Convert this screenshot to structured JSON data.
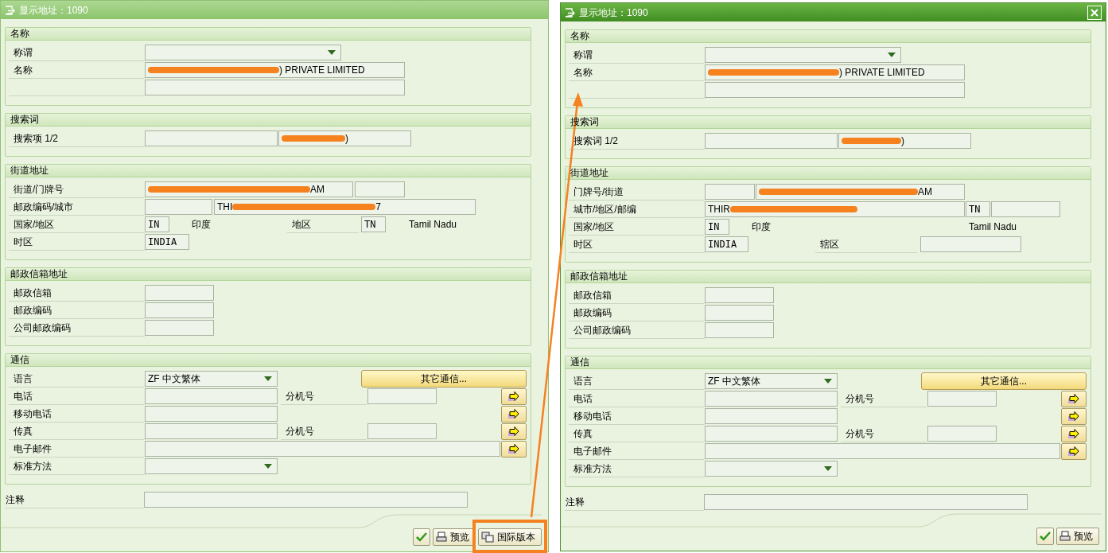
{
  "dialogs": [
    {
      "title": "显示地址：1090",
      "active": false,
      "closable": false,
      "groups": [
        {
          "title": "名称",
          "rows": [
            {
              "label": "称谓",
              "items": [
                {
                  "kind": "dropdown"
                }
              ]
            },
            {
              "label": "名称",
              "items": [
                {
                  "kind": "field",
                  "redacted": true,
                  "value": ") PRIVATE LIMITED"
                }
              ]
            },
            {
              "items": [
                {
                  "kind": "field"
                }
              ]
            }
          ]
        },
        {
          "title": "搜索词",
          "rows": [
            {
              "label": "搜索项 1/2",
              "items": [
                {
                  "kind": "field"
                },
                {
                  "kind": "field",
                  "redacted": true,
                  "value": ")"
                }
              ]
            }
          ]
        },
        {
          "title": "街道地址",
          "rows": [
            {
              "label": "街道/门牌号",
              "items": [
                {
                  "kind": "field",
                  "redacted": true,
                  "value": "AM"
                },
                {
                  "kind": "field"
                }
              ]
            },
            {
              "label": "邮政编码/城市",
              "items": [
                {
                  "kind": "field"
                },
                {
                  "kind": "field",
                  "prefix": "THI",
                  "redacted": true,
                  "value": "7"
                }
              ]
            },
            {
              "label": "国家/地区",
              "items": [
                {
                  "kind": "code_field",
                  "value": "IN"
                },
                {
                  "kind": "text",
                  "text": "印度"
                },
                {
                  "kind": "label",
                  "text": "地区"
                },
                {
                  "kind": "code_field",
                  "value": "TN"
                },
                {
                  "kind": "text",
                  "text": "Tamil Nadu"
                }
              ]
            },
            {
              "label": "时区",
              "items": [
                {
                  "kind": "code_field",
                  "value": "INDIA"
                }
              ]
            }
          ]
        },
        {
          "title": "邮政信箱地址",
          "rows": [
            {
              "label": "邮政信箱",
              "items": [
                {
                  "kind": "field"
                }
              ]
            },
            {
              "label": "邮政编码",
              "items": [
                {
                  "kind": "field"
                }
              ]
            },
            {
              "label": "公司邮政编码",
              "items": [
                {
                  "kind": "field"
                }
              ]
            }
          ]
        },
        {
          "title": "通信",
          "rows": [
            {
              "label": "语言",
              "items": [
                {
                  "kind": "dropdown",
                  "value": "ZF 中文繁体"
                },
                {
                  "kind": "button",
                  "label": "其它通信..."
                }
              ]
            },
            {
              "label": "电话",
              "items": [
                {
                  "kind": "field"
                },
                {
                  "kind": "label",
                  "text": "分机号"
                },
                {
                  "kind": "field"
                },
                {
                  "kind": "arrow_button"
                }
              ]
            },
            {
              "label": "移动电话",
              "items": [
                {
                  "kind": "field"
                },
                {
                  "kind": "arrow_button"
                }
              ]
            },
            {
              "label": "传真",
              "items": [
                {
                  "kind": "field"
                },
                {
                  "kind": "label",
                  "text": "分机号"
                },
                {
                  "kind": "field"
                },
                {
                  "kind": "arrow_button"
                }
              ]
            },
            {
              "label": "电子邮件",
              "items": [
                {
                  "kind": "field"
                },
                {
                  "kind": "arrow_button"
                }
              ]
            },
            {
              "label": "标准方法",
              "items": [
                {
                  "kind": "dropdown"
                }
              ]
            }
          ]
        }
      ],
      "remark": {
        "label": "注释"
      },
      "buttons": [
        {
          "kind": "confirm",
          "highlighted": false
        },
        {
          "kind": "preview",
          "label": "预览",
          "highlighted": false
        },
        {
          "kind": "international",
          "label": "国际版本",
          "highlighted": true
        }
      ]
    },
    {
      "title": "显示地址：1090",
      "active": true,
      "closable": true,
      "groups": [
        {
          "title": "名称",
          "rows": [
            {
              "label": "称谓",
              "items": [
                {
                  "kind": "dropdown"
                }
              ]
            },
            {
              "label": "名称",
              "items": [
                {
                  "kind": "field",
                  "redacted": true,
                  "value": ") PRIVATE LIMITED"
                }
              ]
            },
            {
              "items": [
                {
                  "kind": "field"
                }
              ]
            }
          ]
        },
        {
          "title": "搜索词",
          "rows": [
            {
              "label": "搜索词 1/2",
              "items": [
                {
                  "kind": "field"
                },
                {
                  "kind": "field",
                  "redacted": true,
                  "value": ")"
                }
              ]
            }
          ]
        },
        {
          "title": "街道地址",
          "rows": [
            {
              "label": "门牌号/街道",
              "items": [
                {
                  "kind": "field"
                },
                {
                  "kind": "field",
                  "redacted": true,
                  "value": "AM"
                }
              ]
            },
            {
              "label": "城市/地区/邮编",
              "items": [
                {
                  "kind": "field",
                  "prefix": "THIR",
                  "redacted": true
                },
                {
                  "kind": "code_field",
                  "value": "TN"
                },
                {
                  "kind": "field"
                }
              ]
            },
            {
              "label": "国家/地区",
              "items": [
                {
                  "kind": "code_field",
                  "value": "IN"
                },
                {
                  "kind": "text",
                  "text": "印度"
                },
                {
                  "kind": "text",
                  "text": "Tamil Nadu"
                }
              ]
            },
            {
              "label": "时区",
              "items": [
                {
                  "kind": "code_field",
                  "value": "INDIA"
                },
                {
                  "kind": "label",
                  "text": "辖区"
                },
                {
                  "kind": "field"
                }
              ]
            }
          ]
        },
        {
          "title": "邮政信箱地址",
          "rows": [
            {
              "label": "邮政信箱",
              "items": [
                {
                  "kind": "field"
                }
              ]
            },
            {
              "label": "邮政编码",
              "items": [
                {
                  "kind": "field"
                }
              ]
            },
            {
              "label": "公司邮政编码",
              "items": [
                {
                  "kind": "field"
                }
              ]
            }
          ]
        },
        {
          "title": "通信",
          "rows": [
            {
              "label": "语言",
              "items": [
                {
                  "kind": "dropdown",
                  "value": "ZF 中文繁体"
                },
                {
                  "kind": "button",
                  "label": "其它通信..."
                }
              ]
            },
            {
              "label": "电话",
              "items": [
                {
                  "kind": "field"
                },
                {
                  "kind": "label",
                  "text": "分机号"
                },
                {
                  "kind": "field"
                },
                {
                  "kind": "arrow_button"
                }
              ]
            },
            {
              "label": "移动电话",
              "items": [
                {
                  "kind": "field"
                },
                {
                  "kind": "arrow_button"
                }
              ]
            },
            {
              "label": "传真",
              "items": [
                {
                  "kind": "field"
                },
                {
                  "kind": "label",
                  "text": "分机号"
                },
                {
                  "kind": "field"
                },
                {
                  "kind": "arrow_button"
                }
              ]
            },
            {
              "label": "电子邮件",
              "items": [
                {
                  "kind": "field"
                },
                {
                  "kind": "arrow_button"
                }
              ]
            },
            {
              "label": "标准方法",
              "items": [
                {
                  "kind": "dropdown"
                }
              ]
            }
          ]
        }
      ],
      "remark": {
        "label": "注释"
      },
      "buttons": [
        {
          "kind": "confirm",
          "highlighted": false
        },
        {
          "kind": "preview",
          "label": "预览",
          "highlighted": false
        }
      ]
    }
  ],
  "annotation": {
    "arrow": true
  }
}
